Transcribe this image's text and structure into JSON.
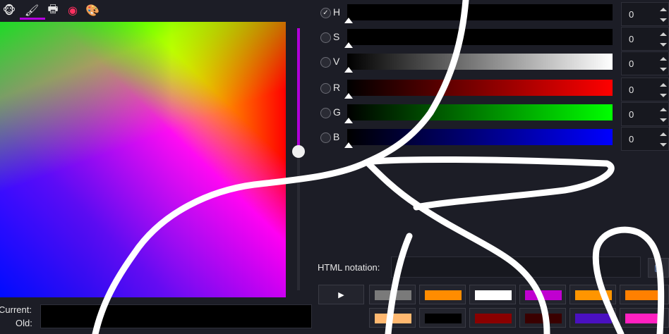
{
  "tabs": [
    {
      "icon": "wilber-icon",
      "glyph": "🐵"
    },
    {
      "icon": "paintbrush-icon",
      "glyph": "🖌"
    },
    {
      "icon": "printer-icon",
      "glyph": "🖶"
    },
    {
      "icon": "color-wheel-icon",
      "glyph": "◉"
    },
    {
      "icon": "palette-icon",
      "glyph": "🎨"
    }
  ],
  "channels": [
    {
      "label": "H",
      "value": "0",
      "checked": true
    },
    {
      "label": "S",
      "value": "0",
      "checked": false
    },
    {
      "label": "V",
      "value": "0",
      "checked": false
    },
    {
      "label": "R",
      "value": "0",
      "checked": false
    },
    {
      "label": "G",
      "value": "0",
      "checked": false
    },
    {
      "label": "B",
      "value": "0",
      "checked": false
    }
  ],
  "html_notation": {
    "label": "HTML notation:",
    "value": ""
  },
  "history_colors": {
    "row1": [
      "#7a7a7a",
      "#ff8c00",
      "#ffffff",
      "#c000d0",
      "#ff9500",
      "#ff8000"
    ],
    "row2": [
      "#ffb870",
      "#000000",
      "#8a0000",
      "#3a0000",
      "#4a10c0",
      "#ff20c0"
    ]
  },
  "current_label": "Current:",
  "old_label": "Old:",
  "accent_color": "#b400e0"
}
